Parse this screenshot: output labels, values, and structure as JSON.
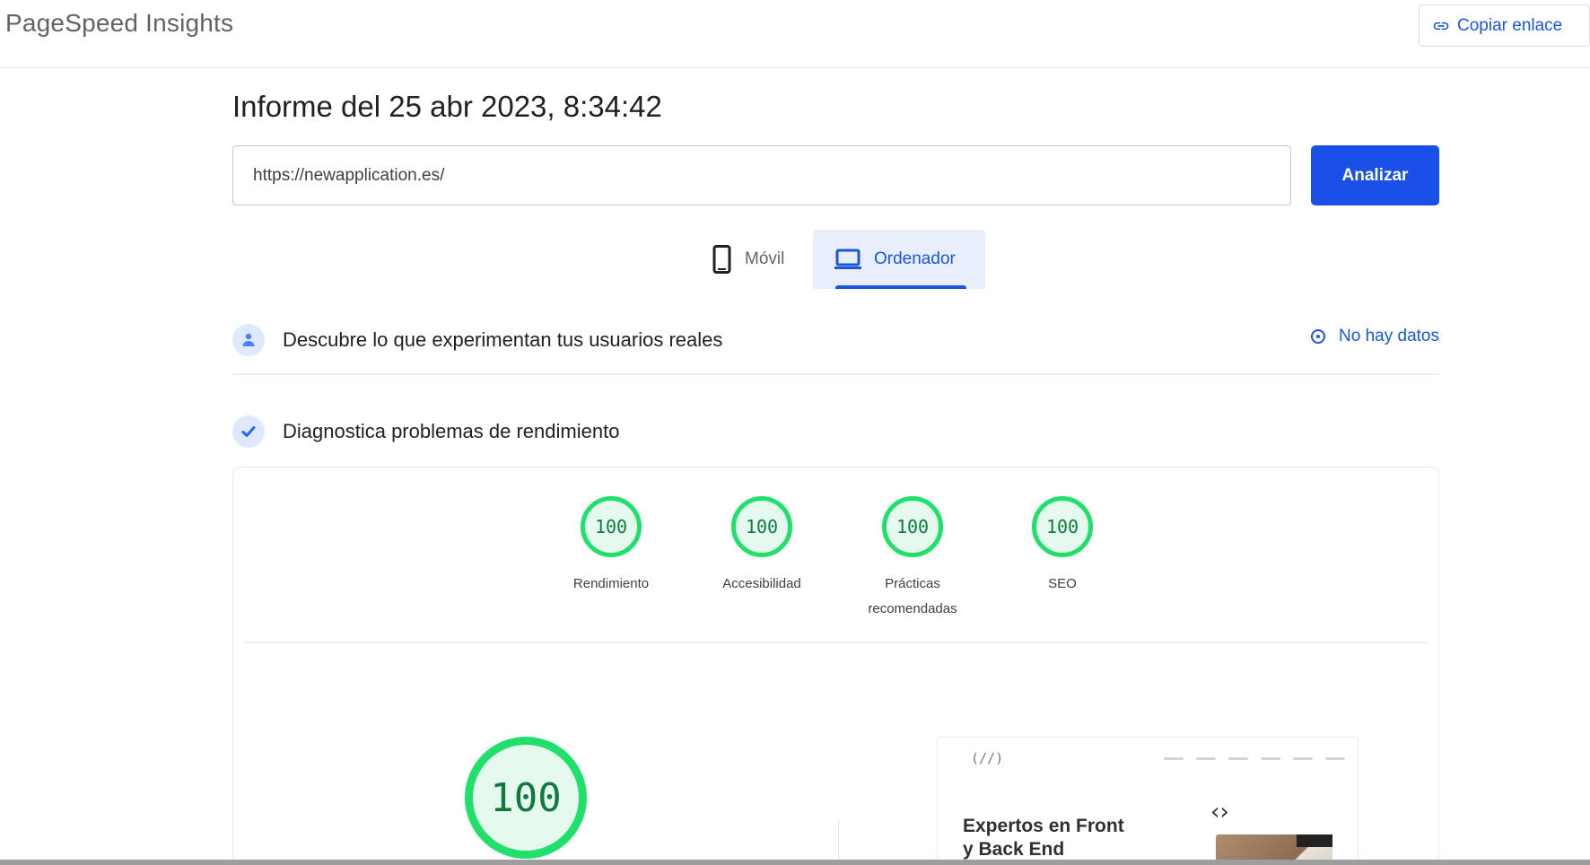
{
  "app": {
    "title": "PageSpeed Insights"
  },
  "toolbar": {
    "copy_link_label": "Copiar enlace",
    "copy_link_icon": "link-icon"
  },
  "report": {
    "title": "Informe del 25 abr 2023, 8:34:42"
  },
  "form": {
    "url_value": "https://newapplication.es/",
    "analyze_label": "Analizar"
  },
  "device_tabs": [
    {
      "label": "Móvil",
      "icon": "phone-icon",
      "selected": false
    },
    {
      "label": "Ordenador",
      "icon": "laptop-icon",
      "selected": true
    }
  ],
  "field_section": {
    "title": "Descubre lo que experimentan tus usuarios reales",
    "status_label": "No hay datos",
    "status_icon": "info-icon"
  },
  "lab_section": {
    "title": "Diagnostica problemas de rendimiento"
  },
  "scores": [
    {
      "label_line1": "Rendimiento",
      "label_line2": "",
      "value": "100"
    },
    {
      "label_line1": "Accesibilidad",
      "label_line2": "",
      "value": "100"
    },
    {
      "label_line1": "Prácticas",
      "label_line2": "recomendadas",
      "value": "100"
    },
    {
      "label_line1": "SEO",
      "label_line2": "",
      "value": "100"
    }
  ],
  "performance": {
    "score": "100"
  },
  "preview": {
    "logo": "(//)",
    "headline_line1": "Expertos en Front",
    "headline_line2": "y Back End",
    "code_glyph": "‹›"
  },
  "colors": {
    "accent": "#1a4fe8",
    "pass": "#1ee06a",
    "pass_text": "#0f7a3f"
  }
}
